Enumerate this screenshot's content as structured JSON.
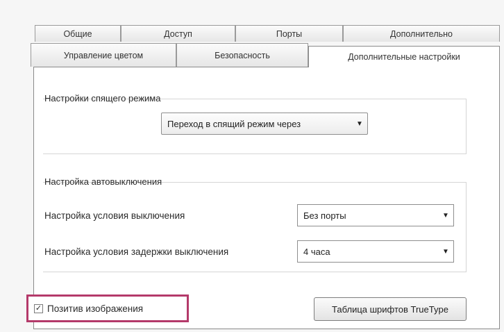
{
  "tabs_row1": [
    "Общие",
    "Доступ",
    "Порты",
    "Дополнительно"
  ],
  "tabs_row2": [
    "Управление цветом",
    "Безопасность",
    "Дополнительные настройки"
  ],
  "active_tab": "Дополнительные настройки",
  "sleep_group": {
    "title": "Настройки спящего режима",
    "select_value": "Переход в спящий режим через"
  },
  "autooff_group": {
    "title": "Настройка автовыключения",
    "condition_label": "Настройка условия выключения",
    "condition_value": "Без порты",
    "delay_label": "Настройка условия задержки выключения",
    "delay_value": "4 часа"
  },
  "image_positive": {
    "label": "Позитив изображения",
    "checked": true,
    "check_glyph": "✓"
  },
  "truetype_button": "Таблица шрифтов TrueType",
  "colors": {
    "highlight_border": "#b43a6a"
  }
}
